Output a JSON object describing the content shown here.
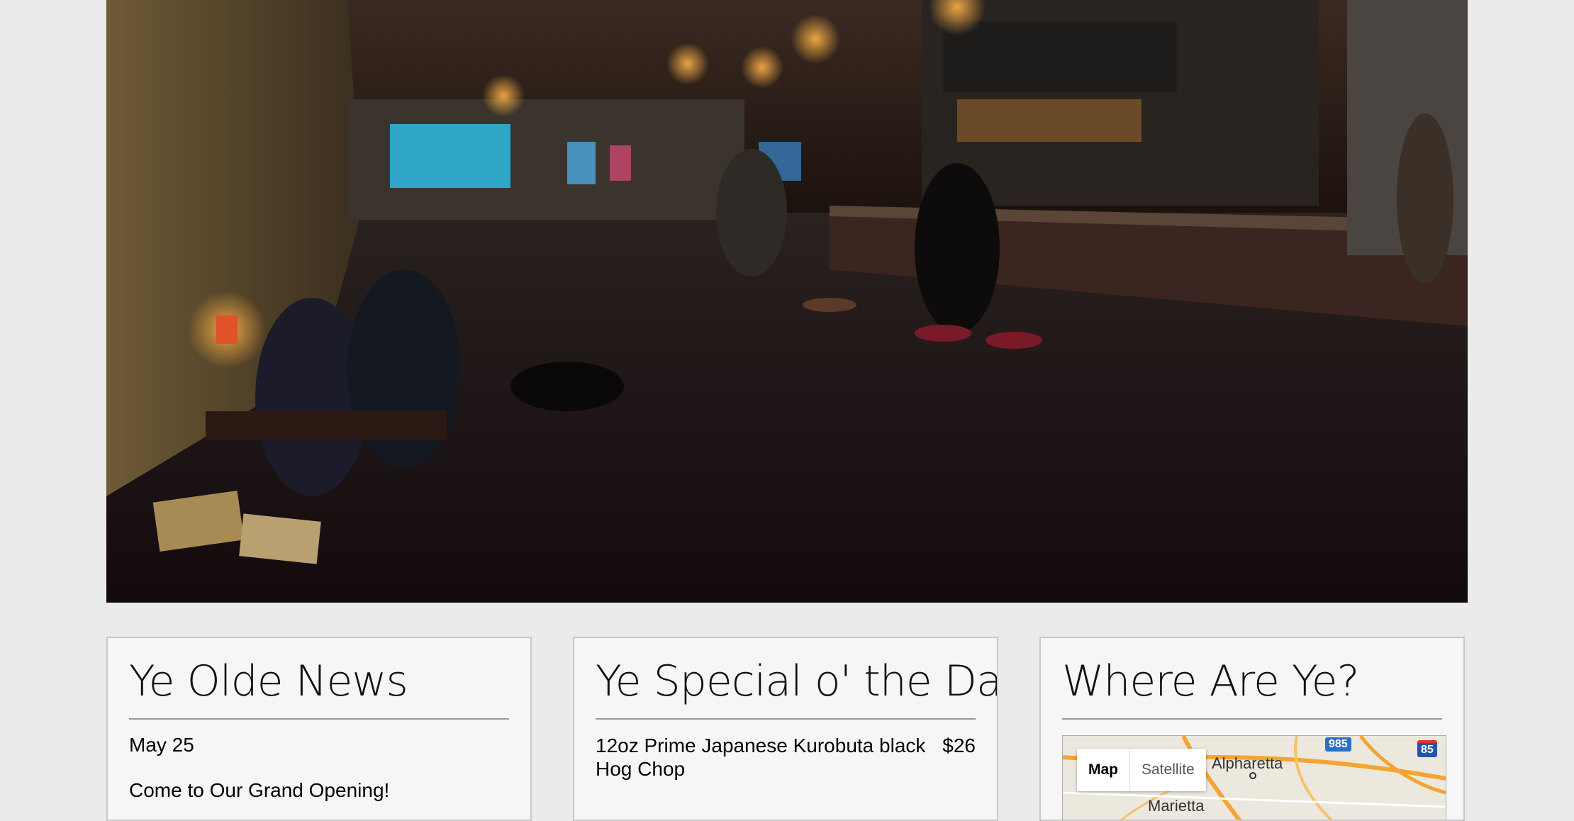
{
  "hero": {
    "image_description_icon": "bar-interior-photo"
  },
  "news": {
    "title": "Ye Olde News",
    "date": "May 25",
    "headline": "Come to Our Grand Opening!"
  },
  "special": {
    "title": "Ye Special o' the Day",
    "item_name": "12oz Prime Japanese Kurobuta black Hog Chop",
    "item_price": "$26"
  },
  "location": {
    "title": "Where Are Ye?",
    "map_button": "Map",
    "satellite_button": "Satellite",
    "city_alpharetta": "Alpharetta",
    "city_marietta": "Marietta",
    "shield_985": "985",
    "shield_85": "85"
  },
  "colors": {
    "page_bg": "#ebebeb",
    "card_bg": "#f6f6f6",
    "map_road": "#f3a533",
    "shield_blue": "#2a6fc7"
  }
}
